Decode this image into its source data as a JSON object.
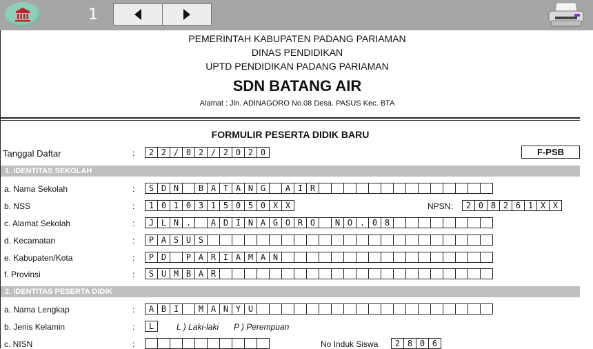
{
  "toolbar": {
    "page_number": "1",
    "icons": {
      "home": "bank-icon",
      "prev": "triangle-left-icon",
      "next": "triangle-right-icon",
      "print": "printer-icon"
    }
  },
  "header": {
    "line1": "PEMERINTAH KABUPATEN PADANG PARIAMAN",
    "line2": "DINAS PENDIDIKAN",
    "line3": "UPTD PENDIDIKAN PADANG PARIAMAN",
    "school": "SDN BATANG AIR",
    "address": "Alamat : Jln. ADINAGORO No.08 Desa. PASUS Kec. BTA"
  },
  "form": {
    "title": "FORMULIR PESERTA DIDIK BARU",
    "code": "F-PSB",
    "date": {
      "label": "Tanggal Daftar",
      "colon": ":",
      "chars": [
        "2",
        "2",
        "/",
        "0",
        "2",
        "/",
        "2",
        "0",
        "2",
        "0"
      ]
    }
  },
  "sections": [
    {
      "title": "1.  IDENTITAS SEKOLAH",
      "fields": [
        {
          "label": "a.  Nama Sekolah",
          "chars": [
            "S",
            "D",
            "N",
            "",
            "B",
            "A",
            "T",
            "A",
            "N",
            "G",
            "",
            "A",
            "I",
            "R",
            "",
            "",
            "",
            "",
            "",
            "",
            "",
            "",
            "",
            "",
            "",
            "",
            "",
            ""
          ]
        },
        {
          "label": "b.  NSS",
          "chars": [
            "1",
            "0",
            "1",
            "0",
            "3",
            "1",
            "5",
            "0",
            "5",
            "0",
            "X",
            "X"
          ]
        },
        {
          "label": "c.  Alamat Sekolah",
          "chars": [
            "J",
            "L",
            "N",
            ".",
            "",
            "A",
            "D",
            "I",
            "N",
            "A",
            "G",
            "O",
            "R",
            "O",
            "",
            "N",
            "O",
            ".",
            "0",
            "8",
            "",
            "",
            "",
            "",
            "",
            "",
            "",
            ""
          ]
        },
        {
          "label": "d.  Kecamatan",
          "chars": [
            "P",
            "A",
            "S",
            "U",
            "S",
            "",
            "",
            "",
            "",
            "",
            "",
            "",
            "",
            "",
            "",
            "",
            "",
            "",
            "",
            "",
            "",
            "",
            "",
            "",
            "",
            "",
            "",
            ""
          ]
        },
        {
          "label": "e.  Kabupaten/Kota",
          "chars": [
            "P",
            "D",
            "",
            "P",
            "A",
            "R",
            "I",
            "A",
            "M",
            "A",
            "N",
            "",
            "",
            "",
            "",
            "",
            "",
            "",
            "",
            "",
            "",
            "",
            "",
            "",
            "",
            "",
            "",
            ""
          ]
        },
        {
          "label": "f.   Provinsi",
          "chars": [
            "S",
            "U",
            "M",
            "B",
            "A",
            "R",
            "",
            "",
            "",
            "",
            "",
            "",
            "",
            "",
            "",
            "",
            "",
            "",
            "",
            "",
            "",
            "",
            "",
            "",
            "",
            "",
            "",
            ""
          ]
        }
      ],
      "npsn": {
        "label": "NPSN",
        "colon": ":",
        "chars": [
          "2",
          "0",
          "8",
          "2",
          "6",
          "1",
          "X",
          "X"
        ]
      }
    },
    {
      "title": "2.  IDENTITAS PESERTA DIDIK",
      "fields": [
        {
          "label": "a.  Nama Lengkap",
          "chars": [
            "A",
            "B",
            "I",
            "",
            "M",
            "A",
            "N",
            "Y",
            "U",
            "",
            "",
            "",
            "",
            "",
            "",
            "",
            "",
            "",
            "",
            "",
            "",
            "",
            "",
            "",
            "",
            "",
            "",
            ""
          ]
        },
        {
          "label": "b.  Jenis Kelamin",
          "chars": [
            "L"
          ]
        },
        {
          "label": "c.  NISN",
          "chars": [
            "",
            "",
            "",
            "",
            "",
            "",
            "",
            "",
            "",
            ""
          ]
        }
      ],
      "gender_options": {
        "male": "L )  Laki-laki",
        "female": "P )  Perempuan"
      },
      "nis": {
        "label": "No Induk Siswa",
        "chars": [
          "2",
          "8",
          "0",
          "6"
        ]
      }
    }
  ],
  "colon": ":"
}
